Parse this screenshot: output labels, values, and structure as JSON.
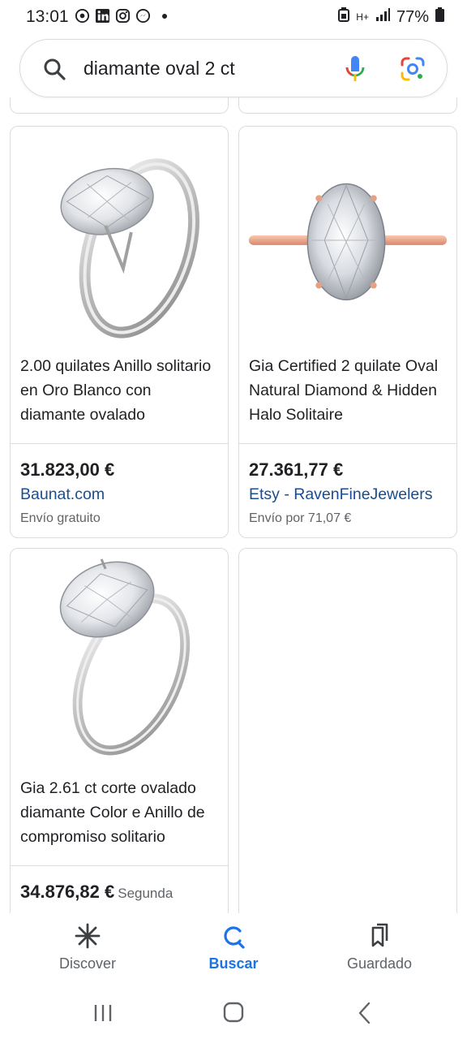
{
  "status_bar": {
    "time": "13:01",
    "left_icons": [
      "camera-app-icon",
      "linkedin-icon",
      "instagram-icon",
      "messenger-icon",
      "more-dot-icon"
    ],
    "network": "H+",
    "battery": "77%"
  },
  "search": {
    "query": "diamante oval 2 ct",
    "icons": [
      "search-icon",
      "microphone-icon",
      "google-lens-icon"
    ]
  },
  "products": [
    {
      "title": "2.00 quilates Anillo solitario en Oro Blanco con diamante ovalado",
      "price": "31.823,00 €",
      "price_suffix": "",
      "seller": "Baunat.com",
      "shipping": "Envío gratuito",
      "image": "white-gold-solitaire-ring"
    },
    {
      "title": "Gia Certified 2 quilate Oval Natural Diamond & Hidden Halo Solitaire",
      "price": "27.361,77 €",
      "price_suffix": "",
      "seller": "Etsy - RavenFineJewelers",
      "shipping": "Envío por 71,07 €",
      "image": "rose-gold-solitaire-ring"
    },
    {
      "title": "Gia 2.61 ct corte ovalado diamante Color e Anillo de compromiso solitario",
      "price": "34.876,82 €",
      "price_suffix": "Segunda",
      "seller": "",
      "shipping": "",
      "image": "white-gold-solitaire-ring"
    }
  ],
  "bottom_nav": [
    {
      "label": "Discover",
      "icon": "asterisk-icon",
      "active": false
    },
    {
      "label": "Buscar",
      "icon": "search-icon",
      "active": true
    },
    {
      "label": "Guardado",
      "icon": "bookmarks-icon",
      "active": false
    }
  ],
  "system_nav": [
    "recents-icon",
    "home-icon",
    "back-icon"
  ],
  "colors": {
    "accent": "#1a73e8",
    "seller_link": "#1a4d8f",
    "text": "#202124",
    "muted": "#5f6368",
    "border": "#dadce0",
    "rose_gold": "#e8a98a"
  }
}
